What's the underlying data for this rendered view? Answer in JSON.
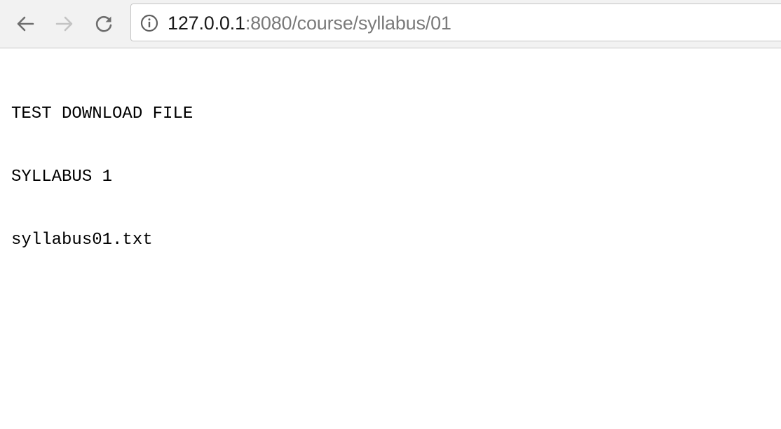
{
  "browser": {
    "address_bar": {
      "host": "127.0.0.1",
      "path": ":8080/course/syllabus/01"
    }
  },
  "document": {
    "lines": [
      "TEST DOWNLOAD FILE",
      "SYLLABUS 1",
      "syllabus01.txt"
    ]
  }
}
